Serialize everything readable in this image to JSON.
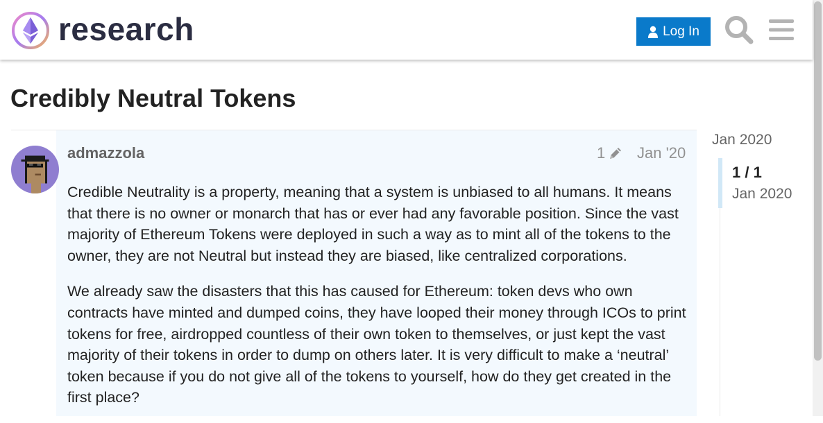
{
  "header": {
    "site_name": "research",
    "login_label": "Log In",
    "icons": {
      "logo": "ethereum-research-logo",
      "user": "user-icon",
      "search": "search-icon",
      "menu": "hamburger-menu-icon"
    },
    "colors": {
      "login_button": "#0a7aca",
      "logo_text": "#2b2d42"
    }
  },
  "topic": {
    "title": "Credibly Neutral Tokens"
  },
  "post": {
    "author": "admazzola",
    "edit_count": "1",
    "date": "Jan '20",
    "paragraphs": [
      "Credible Neutrality is a property, meaning that a system is unbiased to all humans. It means that there is no owner or monarch that has or ever had any favorable position. Since the vast majority of Ethereum Tokens were deployed in such a way as to mint all of the tokens to the owner, they are not Neutral but instead they are biased, like centralized corporations.",
      "We already saw the disasters that this has caused for Ethereum: token devs who own contracts have minted and dumped coins, they have looped their money through ICOs to print tokens for free, airdropped countless of their own token to themselves, or just kept the vast majority of their tokens in order to dump on others later. It is very difficult to make a ‘neutral’ token because if you do not give all of the tokens to yourself, how do they get created in the first place?"
    ],
    "colors": {
      "background": "#f3f9fe"
    }
  },
  "timeline": {
    "start_date": "Jan 2020",
    "position": "1 / 1",
    "current_date": "Jan 2020"
  }
}
